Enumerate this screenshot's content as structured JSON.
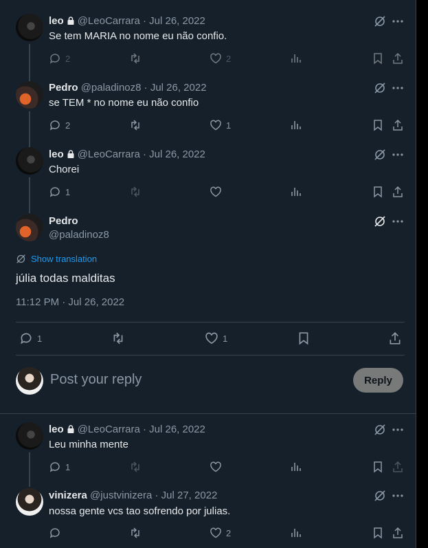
{
  "posts": {
    "p1": {
      "name": "leo",
      "handle": "@LeoCarrara",
      "date": "· Jul 26, 2022",
      "text": "Se tem MARIA no nome eu não confio.",
      "replies": "2",
      "likes": "2"
    },
    "p2": {
      "name": "Pedro",
      "handle": "@paladinoz8",
      "date": "· Jul 26, 2022",
      "text": "se TEM * no nome eu não confio",
      "replies": "2",
      "likes": "1"
    },
    "p3": {
      "name": "leo",
      "handle": "@LeoCarrara",
      "date": "· Jul 26, 2022",
      "text": "Chorei",
      "replies": "1",
      "likes": ""
    },
    "main": {
      "name": "Pedro",
      "handle": "@paladinoz8",
      "show_translation": "Show translation",
      "text": "júlia todas malditas",
      "timestamp": "11:12 PM · Jul 26, 2022",
      "replies": "1",
      "likes": "1"
    },
    "p5": {
      "name": "leo",
      "handle": "@LeoCarrara",
      "date": "· Jul 26, 2022",
      "text": "Leu minha mente",
      "replies": "1",
      "likes": ""
    },
    "p6": {
      "name": "vinizera",
      "handle": "@justvinizera",
      "date": "· Jul 27, 2022",
      "text": "nossa gente vcs tao sofrendo por julias.",
      "replies": "",
      "likes": "2"
    }
  },
  "composer": {
    "placeholder": "Post your reply",
    "reply_button": "Reply"
  },
  "colors": {
    "background": "#15202b",
    "text": "#e7e9ea",
    "secondary": "#8b98a5",
    "link": "#1d9bf0",
    "border": "#38444d"
  },
  "icons": [
    "lock-icon",
    "grok-icon",
    "more-icon",
    "reply-icon",
    "retweet-icon",
    "like-icon",
    "views-icon",
    "bookmark-icon",
    "share-icon",
    "translate-icon"
  ]
}
